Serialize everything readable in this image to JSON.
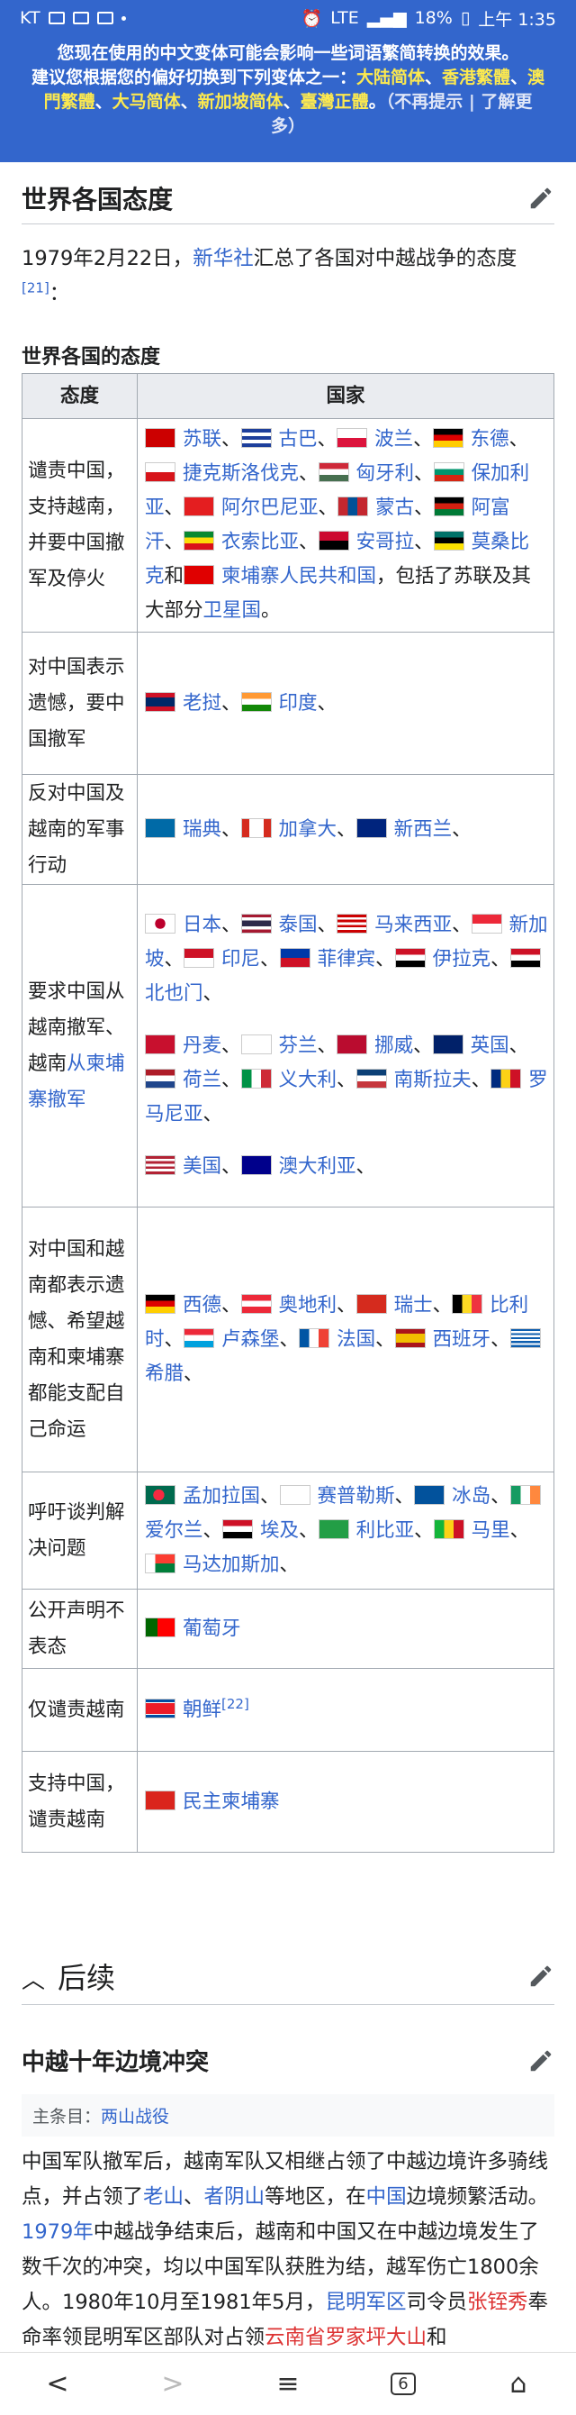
{
  "status_bar": {
    "carrier": "KT",
    "network": "LTE",
    "battery": "18%",
    "time": "上午 1:35"
  },
  "banner": {
    "line1": "您现在使用的中文变体可能会影响一些词语繁简转换的效果。",
    "line2a": "建议您根据您的偏好切换到下列变体之一：",
    "opt1": "大陆简体",
    "sep1": "、",
    "opt2": "香港繁體",
    "sep2": "、",
    "opt3": "澳門繁體",
    "sep3": "、",
    "opt4": "大马简体",
    "sep4": "、",
    "opt5": "新加坡简体",
    "sep5": "、",
    "opt6": "臺灣正體",
    "end": "。",
    "dismiss": "（不再提示",
    "pipe": " | ",
    "learn": "了解更多",
    "close": "）"
  },
  "section1": {
    "title": "世界各国态度",
    "para_pre": "1979年2月22日，",
    "para_link": "新华社",
    "para_post": "汇总了各国对中越战争的态度",
    "para_ref": "[21]",
    "para_end": "：",
    "caption": "世界各国的态度"
  },
  "chart_data": {
    "type": "table",
    "columns": [
      "态度",
      "国家"
    ],
    "rows": [
      {
        "attitude": "谴责中国，支持越南，并要中国撤军及停火",
        "groups": [
          [
            {
              "flag": "soviet",
              "name": "苏联"
            },
            {
              "flag": "cuba",
              "name": "古巴"
            },
            {
              "flag": "poland",
              "name": "波兰"
            },
            {
              "flag": "gdr",
              "name": "东德"
            },
            {
              "flag": "czech",
              "name": "捷克斯洛伐克"
            },
            {
              "flag": "hungary",
              "name": "匈牙利"
            },
            {
              "flag": "bulgaria",
              "name": "保加利亚"
            },
            {
              "flag": "albania",
              "name": "阿尔巴尼亚"
            },
            {
              "flag": "mongolia",
              "name": "蒙古"
            },
            {
              "flag": "afghanistan",
              "name": "阿富汗"
            },
            {
              "flag": "ethiopia",
              "name": "衣索比亚"
            },
            {
              "flag": "angola",
              "name": "安哥拉"
            },
            {
              "flag": "mozambique",
              "name": "莫桑比克"
            },
            {
              "flag": "kampuchea",
              "name": "柬埔寨人民共和国"
            }
          ]
        ],
        "tail_pre": "，包括了苏联及其大部分",
        "tail_link": "卫星国",
        "tail_end": "。"
      },
      {
        "attitude": "对中国表示遗憾，要中国撤军",
        "groups": [
          [
            {
              "flag": "laos",
              "name": "老挝"
            },
            {
              "flag": "india",
              "name": "印度"
            }
          ]
        ]
      },
      {
        "attitude": "反对中国及越南的军事行动",
        "groups": [
          [
            {
              "flag": "sweden",
              "name": "瑞典"
            },
            {
              "flag": "canada",
              "name": "加拿大"
            },
            {
              "flag": "nz",
              "name": "新西兰"
            }
          ]
        ]
      },
      {
        "attitude": "要求中国从越南撤军、越南从柬埔寨撤军",
        "attitude_link": "从柬埔寨撤军",
        "groups": [
          [
            {
              "flag": "japan",
              "name": "日本"
            },
            {
              "flag": "thailand",
              "name": "泰国"
            },
            {
              "flag": "malaysia",
              "name": "马来西亚"
            },
            {
              "flag": "singapore",
              "name": "新加坡"
            },
            {
              "flag": "indonesia",
              "name": "印尼"
            },
            {
              "flag": "philippines",
              "name": "菲律宾"
            },
            {
              "flag": "iraq",
              "name": "伊拉克"
            },
            {
              "flag": "yemen",
              "name": "北也门"
            }
          ],
          [
            {
              "flag": "denmark",
              "name": "丹麦"
            },
            {
              "flag": "finland",
              "name": "芬兰"
            },
            {
              "flag": "norway",
              "name": "挪威"
            },
            {
              "flag": "uk",
              "name": "英国"
            },
            {
              "flag": "netherlands",
              "name": "荷兰"
            },
            {
              "flag": "italy",
              "name": "义大利"
            },
            {
              "flag": "yugoslavia",
              "name": "南斯拉夫"
            },
            {
              "flag": "romania",
              "name": "罗马尼亚"
            }
          ],
          [
            {
              "flag": "usa",
              "name": "美国"
            },
            {
              "flag": "australia",
              "name": "澳大利亚"
            }
          ]
        ]
      },
      {
        "attitude": "对中国和越南都表示遗憾、希望越南和柬埔寨都能支配自己命运",
        "groups": [
          [
            {
              "flag": "frg",
              "name": "西德"
            },
            {
              "flag": "austria",
              "name": "奥地利"
            },
            {
              "flag": "switzerland",
              "name": "瑞士"
            },
            {
              "flag": "belgium",
              "name": "比利时"
            },
            {
              "flag": "luxembourg",
              "name": "卢森堡"
            },
            {
              "flag": "france",
              "name": "法国"
            },
            {
              "flag": "spain",
              "name": "西班牙"
            },
            {
              "flag": "greece",
              "name": "希腊"
            }
          ]
        ]
      },
      {
        "attitude": "呼吁谈判解决问题",
        "groups": [
          [
            {
              "flag": "bangladesh",
              "name": "孟加拉国"
            },
            {
              "flag": "cyprus",
              "name": "赛普勒斯"
            },
            {
              "flag": "iceland",
              "name": "冰岛"
            },
            {
              "flag": "ireland",
              "name": "爱尔兰"
            },
            {
              "flag": "egypt",
              "name": "埃及"
            },
            {
              "flag": "libya",
              "name": "利比亚"
            },
            {
              "flag": "mali",
              "name": "马里"
            },
            {
              "flag": "madagascar",
              "name": "马达加斯加"
            }
          ]
        ]
      },
      {
        "attitude": "公开声明不表态",
        "groups": [
          [
            {
              "flag": "portugal",
              "name": "葡萄牙"
            }
          ]
        ]
      },
      {
        "attitude": "仅谴责越南",
        "groups": [
          [
            {
              "flag": "northkorea",
              "name": "朝鲜",
              "ref": "[22]"
            }
          ]
        ]
      },
      {
        "attitude": "支持中国，谴责越南",
        "groups": [
          [
            {
              "flag": "dk",
              "name": "民主柬埔寨"
            }
          ]
        ]
      }
    ]
  },
  "section2": {
    "title": "后续"
  },
  "section3": {
    "title": "中越十年边境冲突",
    "hatnote_pre": "主条目：",
    "hatnote_link": "两山战役",
    "p1": "中国军队撤军后，越南军队又相继占领了中越边境许多骑线点，并占领了",
    "p1_l1": "老山",
    "p1_s1": "、",
    "p1_l2": "者阴山",
    "p1_s2": "等地区，在",
    "p1_l3": "中国",
    "p1_s3": "边境频繁活动。",
    "p1_l4": "1979年",
    "p1_s4": "中越战争结束后，越南和中国又在中越边境发生了数千次的冲突，均以中国军队获胜为结，越军伤亡1800余人。1980年10月至1981年5月，",
    "p1_l5": "昆明军区",
    "p1_s5": "司令员",
    "p1_l6": "张铚秀",
    "p1_s6": "奉命率领昆明军区部队对占领",
    "p1_l7": "云南省罗家坪大山",
    "p1_s7": "和"
  },
  "nav": {
    "back": "<",
    "forward": ">",
    "menu": "≡",
    "tabs": "6",
    "home": "⌂"
  }
}
